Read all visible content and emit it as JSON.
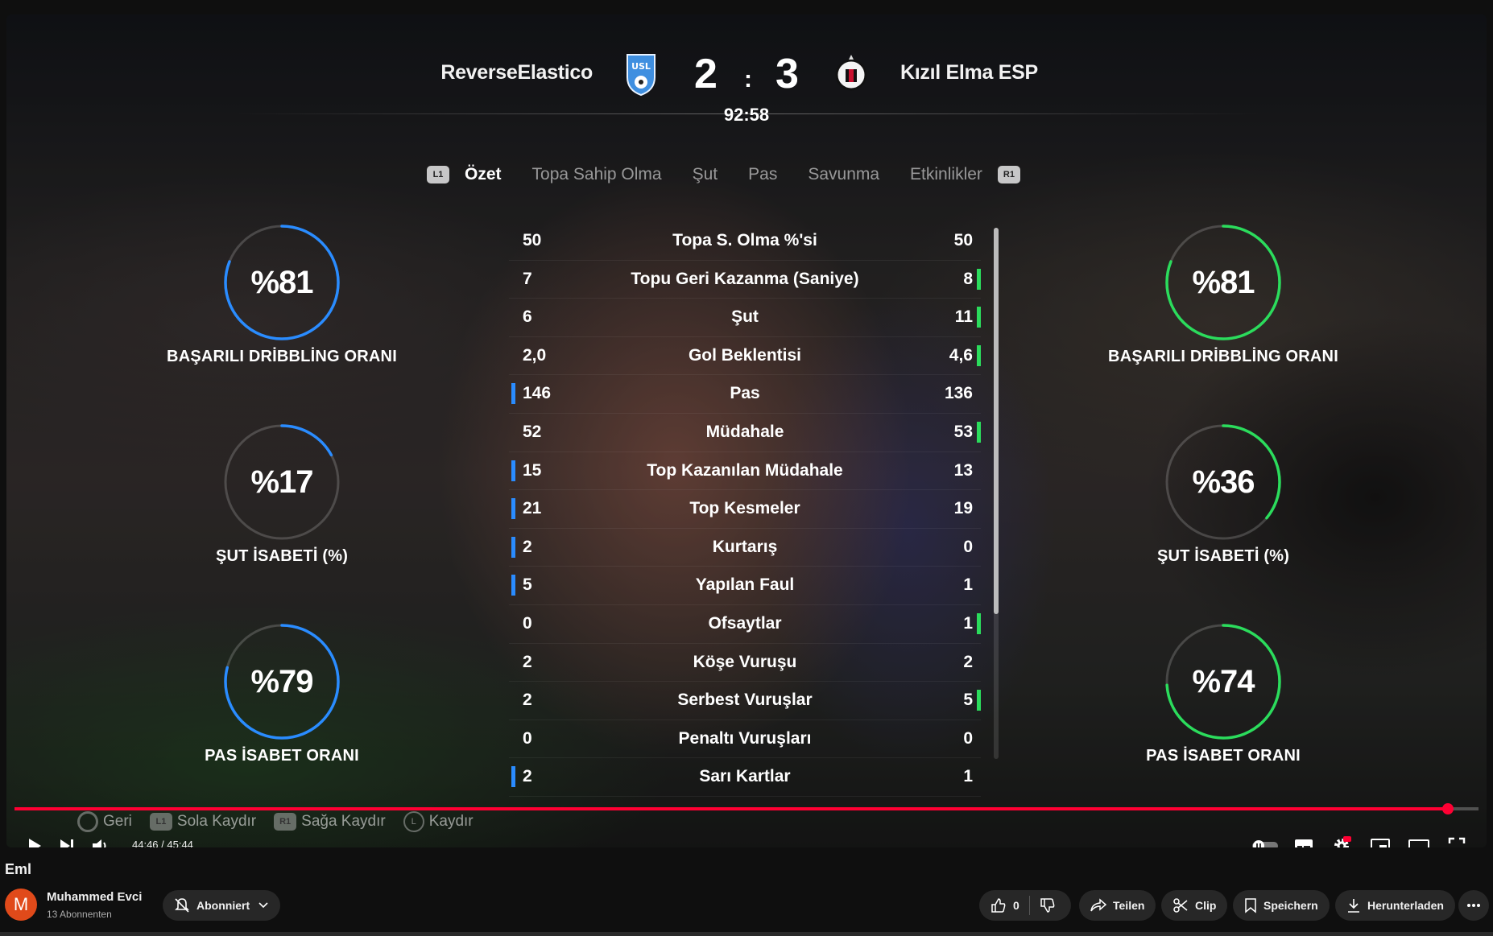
{
  "match": {
    "home_team": "ReverseElastico",
    "away_team": "Kızıl Elma ESP",
    "home_score": "2",
    "away_score": "3",
    "separator": ":",
    "clock": "92:58"
  },
  "tabs": {
    "left_hint": "L1",
    "right_hint": "R1",
    "items": [
      "Özet",
      "Topa Sahip Olma",
      "Şut",
      "Pas",
      "Savunma",
      "Etkinlikler"
    ],
    "active": "Özet"
  },
  "stats": [
    {
      "label": "Topa S. Olma %'si",
      "home": "50",
      "away": "50",
      "lead": "none"
    },
    {
      "label": "Topu Geri Kazanma (Saniye)",
      "home": "7",
      "away": "8",
      "lead": "away"
    },
    {
      "label": "Şut",
      "home": "6",
      "away": "11",
      "lead": "away"
    },
    {
      "label": "Gol Beklentisi",
      "home": "2,0",
      "away": "4,6",
      "lead": "away"
    },
    {
      "label": "Pas",
      "home": "146",
      "away": "136",
      "lead": "home"
    },
    {
      "label": "Müdahale",
      "home": "52",
      "away": "53",
      "lead": "away"
    },
    {
      "label": "Top Kazanılan Müdahale",
      "home": "15",
      "away": "13",
      "lead": "home"
    },
    {
      "label": "Top Kesmeler",
      "home": "21",
      "away": "19",
      "lead": "home"
    },
    {
      "label": "Kurtarış",
      "home": "2",
      "away": "0",
      "lead": "home"
    },
    {
      "label": "Yapılan Faul",
      "home": "5",
      "away": "1",
      "lead": "home"
    },
    {
      "label": "Ofsaytlar",
      "home": "0",
      "away": "1",
      "lead": "away"
    },
    {
      "label": "Köşe Vuruşu",
      "home": "2",
      "away": "2",
      "lead": "none"
    },
    {
      "label": "Serbest Vuruşlar",
      "home": "2",
      "away": "5",
      "lead": "away"
    },
    {
      "label": "Penaltı Vuruşları",
      "home": "0",
      "away": "0",
      "lead": "none"
    },
    {
      "label": "Sarı Kartlar",
      "home": "2",
      "away": "1",
      "lead": "home"
    }
  ],
  "gauges": {
    "home": [
      {
        "value": "%81",
        "label": "BAŞARILI DRİBBLİNG ORANI",
        "fraction": 0.81
      },
      {
        "value": "%17",
        "label": "ŞUT İSABETİ (%)",
        "fraction": 0.17
      },
      {
        "value": "%79",
        "label": "PAS İSABET ORANI",
        "fraction": 0.79
      }
    ],
    "away": [
      {
        "value": "%81",
        "label": "BAŞARILI DRİBBLİNG ORANI",
        "fraction": 0.81
      },
      {
        "value": "%36",
        "label": "ŞUT İSABETİ (%)",
        "fraction": 0.36
      },
      {
        "value": "%74",
        "label": "PAS İSABET ORANI",
        "fraction": 0.74
      }
    ]
  },
  "colors": {
    "home_accent": "#2a8cff",
    "away_accent": "#2bdc5c",
    "progress": "#ff0033"
  },
  "controller_hints": [
    {
      "icon": "circle-button-icon",
      "label": "Geri"
    },
    {
      "icon": "L1",
      "label": "Sola Kaydır"
    },
    {
      "icon": "R1",
      "label": "Sağa Kaydır"
    },
    {
      "icon": "left-stick-icon",
      "label": "Kaydır"
    }
  ],
  "player": {
    "time": "44:46 / 45:44",
    "progress_fraction": 0.979
  },
  "video": {
    "title": "Eml",
    "channel_initial": "M",
    "channel_name": "Muhammed Evci",
    "subscribers": "13 Abonnenten",
    "subscribe_label": "Abonniert",
    "like_count": "0",
    "share_label": "Teilen",
    "clip_label": "Clip",
    "save_label": "Speichern",
    "download_label": "Herunterladen"
  }
}
